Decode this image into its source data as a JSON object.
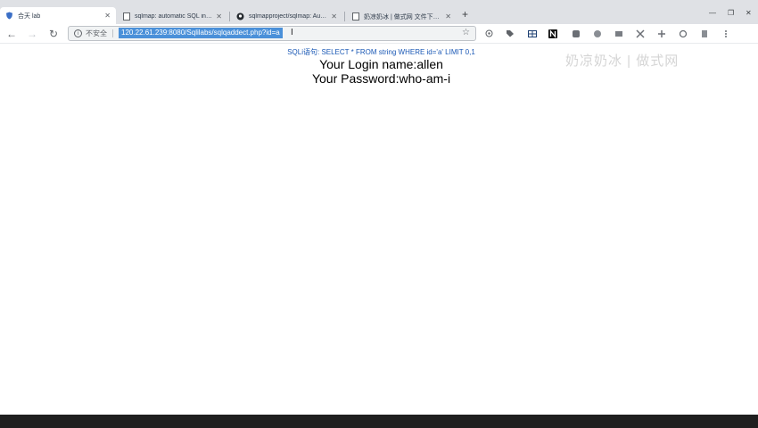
{
  "tabs": [
    {
      "title": "合天 lab",
      "icon": "shield-icon",
      "active": true
    },
    {
      "title": "sqlmap: automatic SQL injection",
      "icon": "page-icon",
      "active": false
    },
    {
      "title": "sqlmapproject/sqlmap: Automatic",
      "icon": "github-icon",
      "active": false
    },
    {
      "title": "奶凉奶冰 | 做式网 文件下载平台",
      "icon": "page-icon",
      "active": false
    }
  ],
  "toolbar": {
    "security_label": "不安全",
    "url": "120.22.61.239:8080/Sqlilabs/sqlqaddect.php?id=a"
  },
  "content": {
    "sql_label": "SQLi语句:",
    "sql_text": "SELECT * FROM string WHERE id='a' LIMIT 0,1",
    "login_prefix": "Your Login name:",
    "login_value": "allen",
    "password_prefix": "Your Password:",
    "password_value": "who-am-i"
  },
  "watermark": "奶凉奶冰 | 做式网",
  "colors": {
    "tabstrip": "#dfe1e5",
    "url_highlight": "#4a90d9",
    "sql_text": "#1a58b5",
    "taskbar": "#1f1f1f"
  }
}
